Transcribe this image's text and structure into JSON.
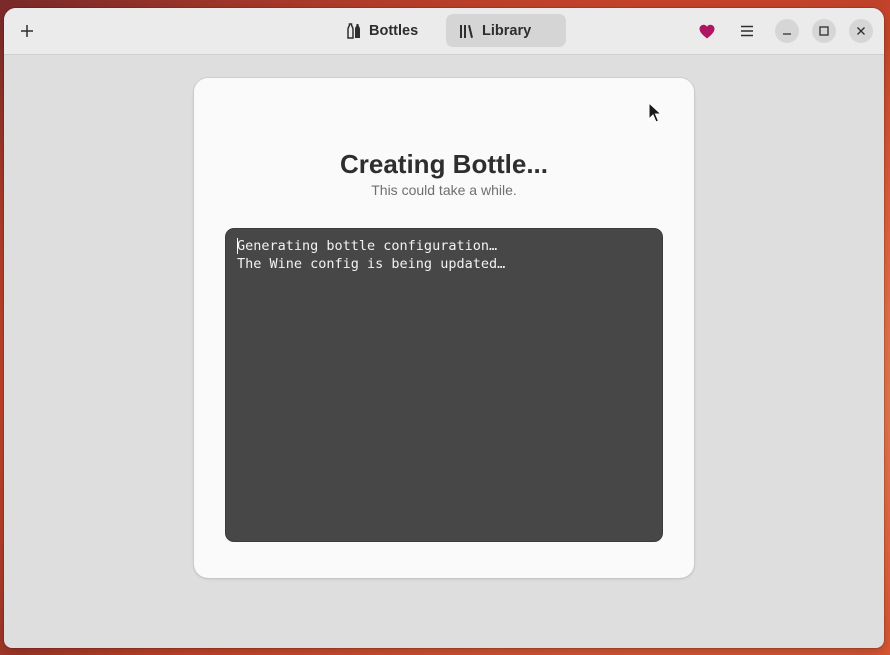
{
  "header": {
    "tabs": [
      {
        "label": "Bottles",
        "icon": "bottles-icon",
        "selected": false
      },
      {
        "label": "Library",
        "icon": "library-icon",
        "selected": true
      }
    ],
    "heart_color": "#b01561"
  },
  "dialog": {
    "title": "Creating Bottle...",
    "subtitle": "This could take a while.",
    "log": [
      "Generating bottle configuration…",
      "The Wine config is being updated…"
    ]
  }
}
